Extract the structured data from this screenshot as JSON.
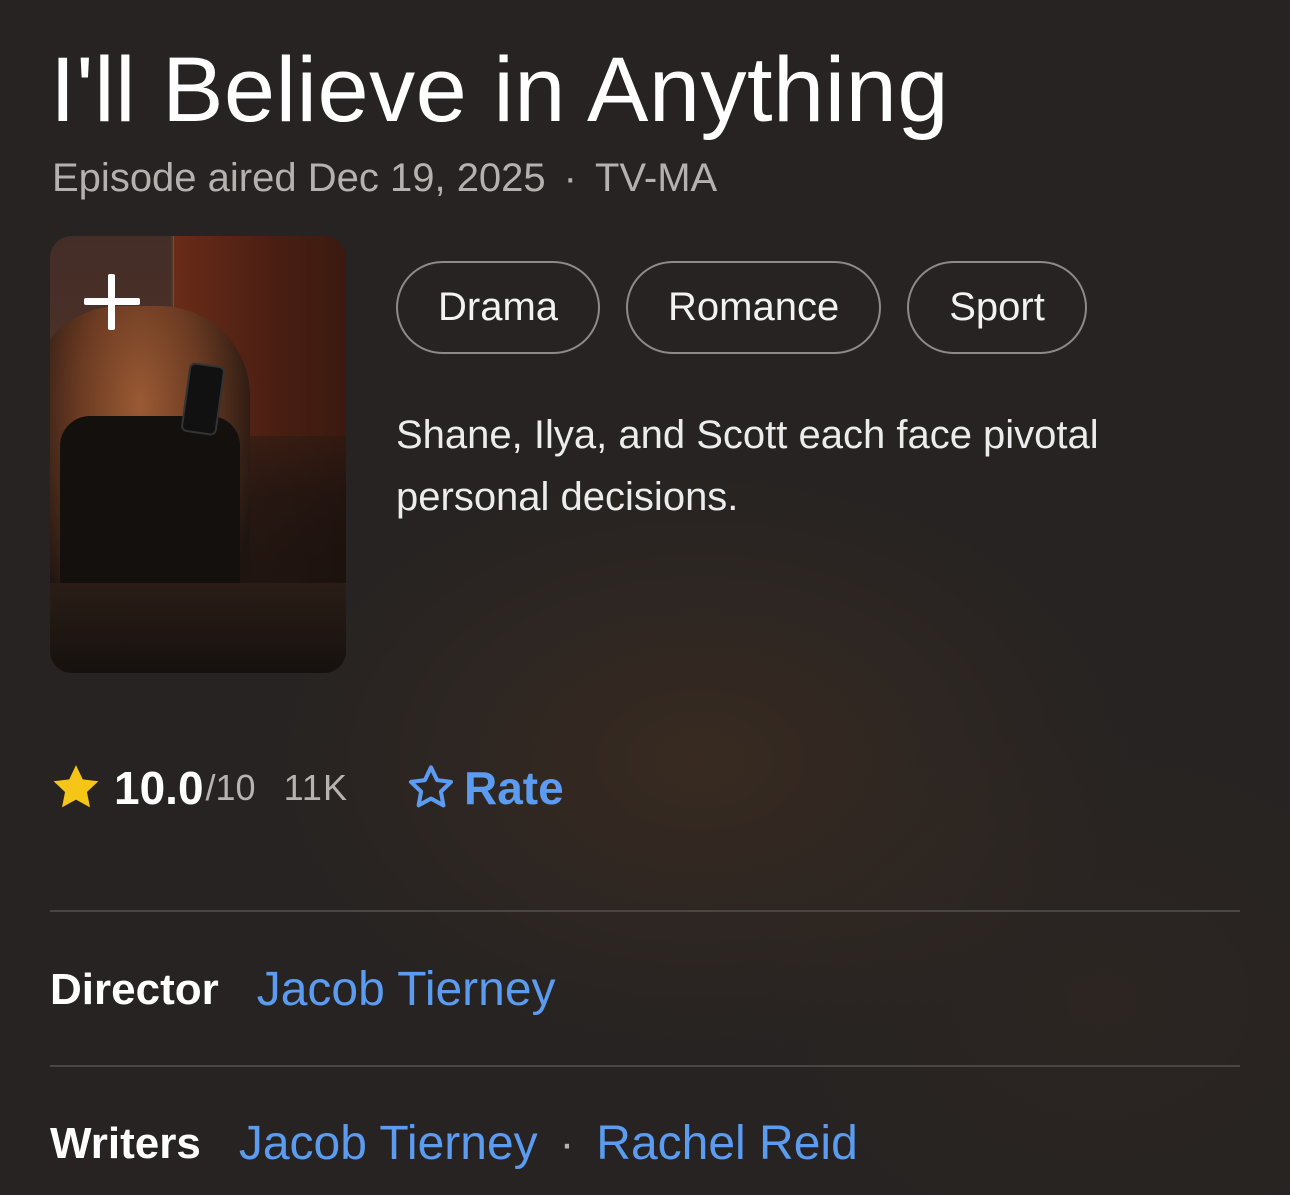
{
  "episode": {
    "title": "I'll Believe in Anything",
    "aired": "Episode aired Dec 19, 2025",
    "separator": "·",
    "rating_cert": "TV-MA"
  },
  "genres": [
    "Drama",
    "Romance",
    "Sport"
  ],
  "synopsis": "Shane, Ilya, and Scott each face pivotal personal decisions.",
  "rating": {
    "score": "10.0",
    "out_of": "/10",
    "count": "11K",
    "rate_label": "Rate",
    "star_color": "#f5c518",
    "link_color": "#5b9bf0"
  },
  "credits": {
    "director_label": "Director",
    "director": "Jacob Tierney",
    "writers_label": "Writers",
    "writers": [
      "Jacob Tierney",
      "Rachel Reid"
    ],
    "separator": "·"
  },
  "icons": {
    "add_to_watchlist": "plus-icon",
    "rating_star": "star-icon",
    "rate_star": "star-outline-icon"
  }
}
